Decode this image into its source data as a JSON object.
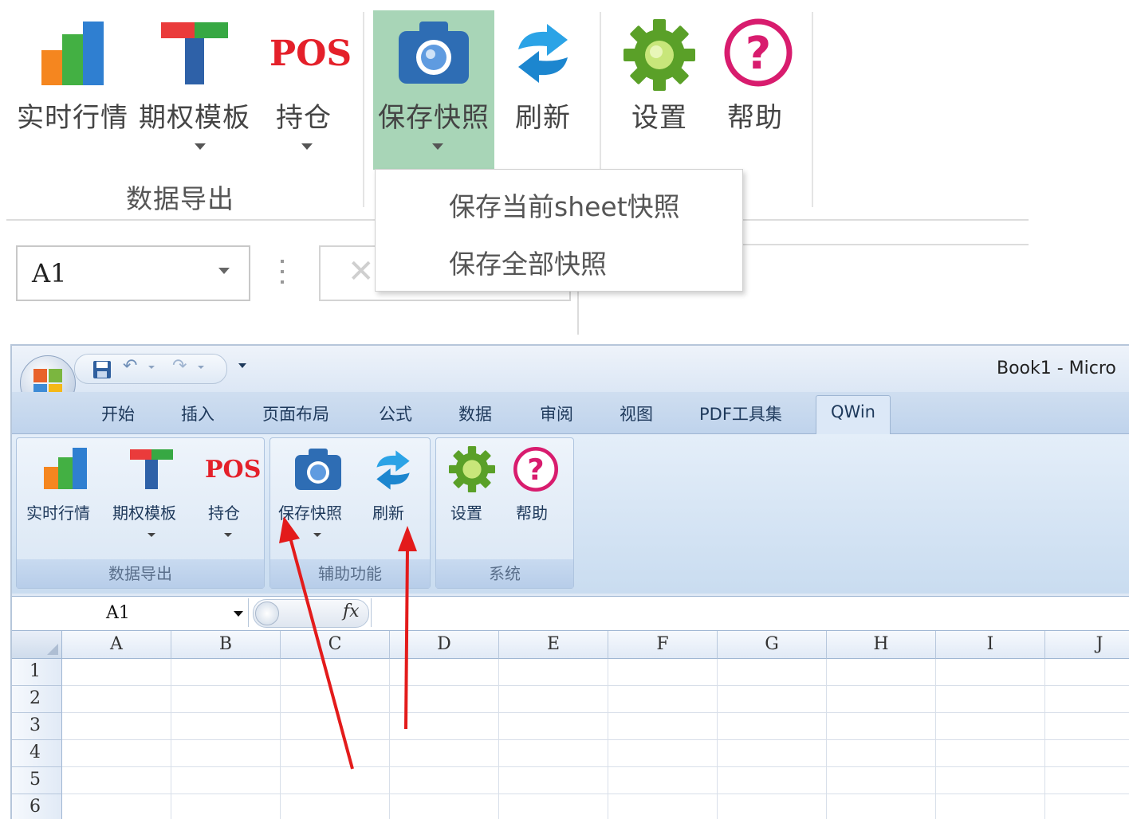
{
  "top_ribbon": {
    "buttons": [
      {
        "label": "实时行情"
      },
      {
        "label": "期权模板"
      },
      {
        "label": "持仓",
        "icon_text": "POS"
      },
      {
        "label": "保存快照"
      },
      {
        "label": "刷新"
      },
      {
        "label": "设置"
      },
      {
        "label": "帮助",
        "icon_text": "?"
      }
    ],
    "group_label": "数据导出",
    "dropdown_items": [
      "保存当前sheet快照",
      "保存全部快照"
    ],
    "name_box": "A1",
    "colors": {
      "active_button_bg": "#a8d5b7",
      "pos_red": "#e4202a",
      "camera_blue": "#2e6db4",
      "gear_green": "#5aa028",
      "help_pink": "#d81c6e"
    }
  },
  "excel": {
    "window_title": "Book1 - Micro",
    "tabs": [
      "开始",
      "插入",
      "页面布局",
      "公式",
      "数据",
      "审阅",
      "视图",
      "PDF工具集",
      "QWin"
    ],
    "active_tab": "QWin",
    "groups": [
      {
        "name": "数据导出",
        "buttons": [
          "实时行情",
          "期权模板",
          "持仓"
        ]
      },
      {
        "name": "辅助功能",
        "buttons": [
          "保存快照",
          "刷新"
        ]
      },
      {
        "name": "系统",
        "buttons": [
          "设置",
          "帮助"
        ]
      }
    ],
    "pos_text": "POS",
    "help_text": "?",
    "name_box": "A1",
    "fx_label": "fx",
    "columns": [
      "A",
      "B",
      "C",
      "D",
      "E",
      "F",
      "G",
      "H",
      "I",
      "J"
    ],
    "rows": [
      "1",
      "2",
      "3",
      "4",
      "5",
      "6"
    ]
  }
}
